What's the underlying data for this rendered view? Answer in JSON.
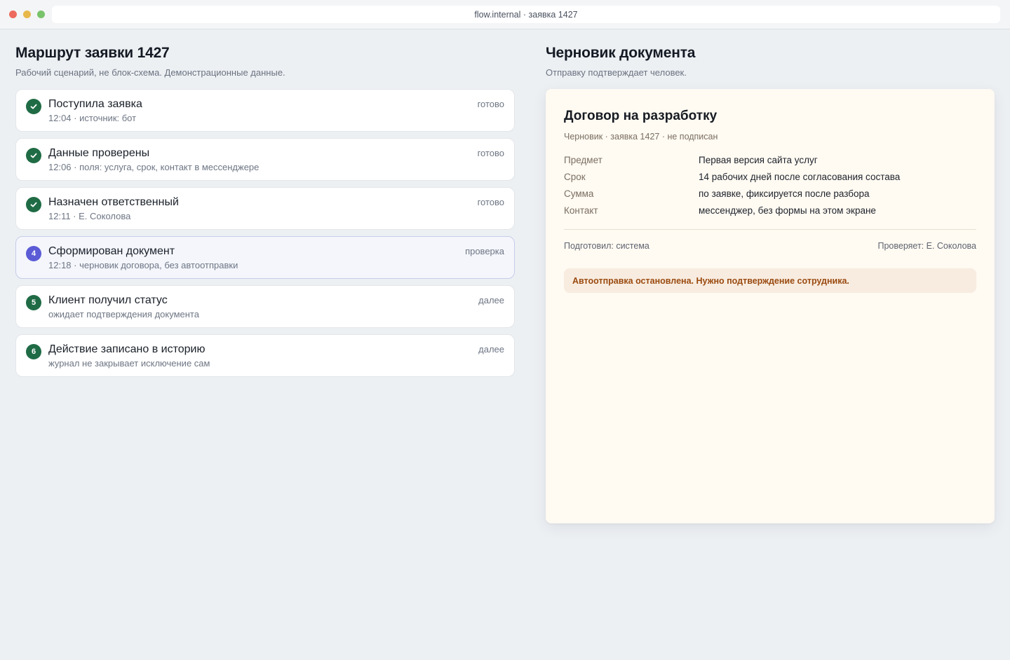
{
  "browser": {
    "url": "flow.internal · заявка 1427"
  },
  "route": {
    "title": "Маршрут заявки 1427",
    "subtitle": "Рабочий сценарий, не блок-схема. Демонстрационные данные.",
    "steps": [
      {
        "number": "1",
        "title": "Поступила заявка",
        "meta": "12:04 · источник: бот",
        "status": "готово",
        "done": true
      },
      {
        "number": "2",
        "title": "Данные проверены",
        "meta": "12:06 · поля: услуга, срок, контакт в мессенджере",
        "status": "готово",
        "done": true
      },
      {
        "number": "3",
        "title": "Назначен ответственный",
        "meta": "12:11 · Е. Соколова",
        "status": "готово",
        "done": true
      },
      {
        "number": "4",
        "title": "Сформирован документ",
        "meta": "12:18 · черновик договора, без автоотправки",
        "status": "проверка",
        "done": false
      },
      {
        "number": "5",
        "title": "Клиент получил статус",
        "meta": "ожидает подтверждения документа",
        "status": "далее",
        "done": false
      },
      {
        "number": "6",
        "title": "Действие записано в историю",
        "meta": "журнал не закрывает исключение сам",
        "status": "далее",
        "done": false
      }
    ]
  },
  "draft": {
    "title": "Черновик документа",
    "subtitle": "Отправку подтверждает человек.",
    "document": {
      "title": "Договор на разработку",
      "subtitle": "Черновик · заявка 1427 · не подписан",
      "fields": [
        {
          "label": "Предмет",
          "value": "Первая версия сайта услуг"
        },
        {
          "label": "Срок",
          "value": "14 рабочих дней после согласования состава"
        },
        {
          "label": "Сумма",
          "value": "по заявке, фиксируется после разбора"
        },
        {
          "label": "Контакт",
          "value": "мессенджер, без формы на этом экране"
        }
      ],
      "prepared_by": "Подготовил: система",
      "reviewed_by": "Проверяет: Е. Соколова",
      "warning": "Автоотправка остановлена. Нужно подтверждение сотрудника."
    }
  },
  "colors": {
    "done": "#1f6b45",
    "active": "#5b5bd6",
    "warning_text": "#9a4a10",
    "warning_bg": "#f8ece0"
  }
}
